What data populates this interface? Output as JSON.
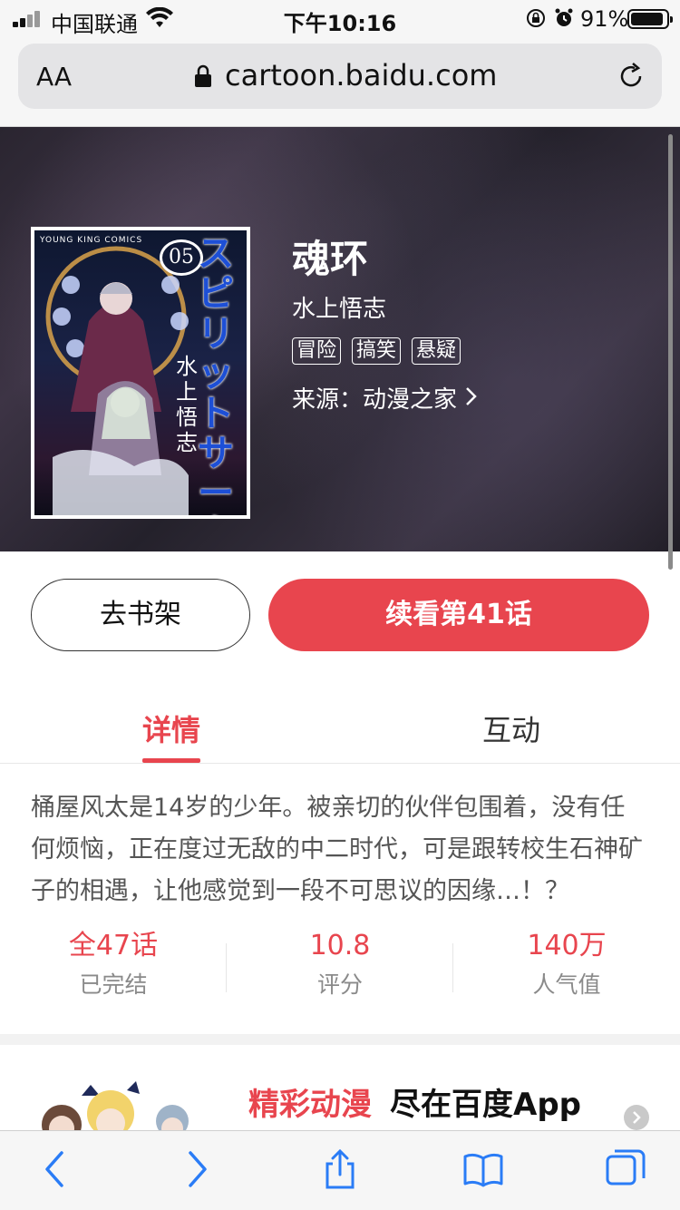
{
  "status_bar": {
    "carrier": "中国联通",
    "time": "下午10:16",
    "battery_percent": "91%",
    "battery_level": 0.91,
    "icons": [
      "signal-icon",
      "wifi-icon",
      "orientation-lock-icon",
      "alarm-icon",
      "battery-icon"
    ]
  },
  "browser": {
    "text_size_label": "AA",
    "url": "cartoon.baidu.com"
  },
  "comic": {
    "title": "魂环",
    "author": "水上悟志",
    "tags": [
      "冒险",
      "搞笑",
      "悬疑"
    ],
    "source": "来源：动漫之家",
    "cover": {
      "publisher": "YOUNG KING COMICS",
      "volume": "05",
      "title_text": "スピリットサークル",
      "author_text": "水上悟志"
    }
  },
  "actions": {
    "shelf_label": "去书架",
    "continue_label": "续看第41话"
  },
  "tabs": [
    {
      "label": "详情",
      "active": true
    },
    {
      "label": "互动",
      "active": false
    }
  ],
  "synopsis": "桶屋风太是14岁的少年。被亲切的伙伴包围着，没有任何烦恼，正在度过无敌的中二时代，可是跟转校生石神矿子的相遇，让他感觉到一段不可思议的因缘…！？",
  "stats": [
    {
      "value": "全47话",
      "label": "已完结"
    },
    {
      "value": "10.8",
      "label": "评分"
    },
    {
      "value": "140万",
      "label": "人气值"
    }
  ],
  "promo": {
    "highlight": "精彩动漫",
    "text": "尽在百度App"
  },
  "toolbar": {
    "icons": [
      "back-icon",
      "forward-icon",
      "share-icon",
      "bookmarks-icon",
      "tabs-icon"
    ]
  },
  "colors": {
    "accent": "#e8454e",
    "text_secondary": "#8a8a8a"
  }
}
